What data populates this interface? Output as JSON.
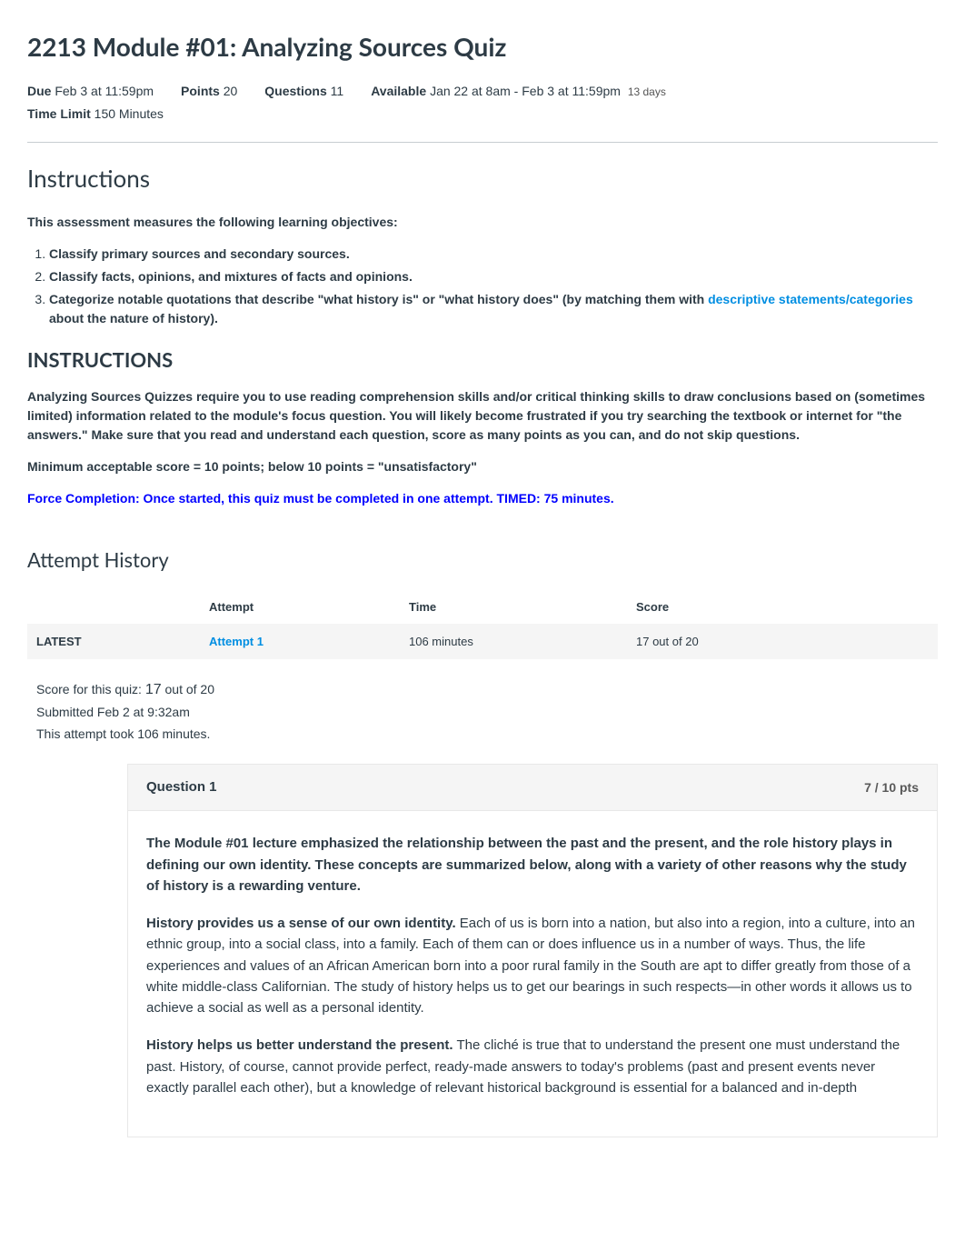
{
  "title": "2213 Module #01: Analyzing Sources Quiz",
  "meta": {
    "due_label": "Due",
    "due_value": "Feb 3 at 11:59pm",
    "points_label": "Points",
    "points_value": "20",
    "questions_label": "Questions",
    "questions_value": "11",
    "available_label": "Available",
    "available_value": "Jan 22 at 8am - Feb 3 at 11:59pm",
    "available_extra": "13 days",
    "timelimit_label": "Time Limit",
    "timelimit_value": "150 Minutes"
  },
  "instructions_heading": "Instructions",
  "objectives_intro": "This assessment measures the following learning objectives:",
  "objectives": {
    "o1": "Classify primary sources and secondary sources.",
    "o2": "Classify facts, opinions, and mixtures of facts and opinions.",
    "o3_lead": "Categorize notable quotations that describe \"what history is\" or \"what history does\" ",
    "o3_paren_a": "(by matching them with ",
    "o3_link": "descriptive statements/categories",
    "o3_paren_b": " about the nature of history)."
  },
  "sub_heading": "INSTRUCTIONS",
  "para1_a": "Analyzing Sources Quizzes require you to use reading comprehension skills and/or critical thinking skills to draw conclusions based on (sometimes limited) information related to the module's focus question. You will likely become frustrated if you try searching the textbook or internet for \"the answers.\"",
  "para1_b": " Make sure that you read and understand each question, score as many points as you can, and do not skip questions.",
  "para2": "Minimum acceptable score = 10 points; below 10 points = \"unsatisfactory\"",
  "para3": "Force Completion: Once started, this quiz must be completed in one attempt. TIMED: 75 minutes.",
  "attempt_heading": "Attempt History",
  "table": {
    "col_blank": "",
    "col_attempt": "Attempt",
    "col_time": "Time",
    "col_score": "Score",
    "row_latest": "LATEST",
    "row_attempt": "Attempt 1",
    "row_time": "106 minutes",
    "row_score": "17 out of 20"
  },
  "summary": {
    "line1_a": "Score for this quiz: ",
    "line1_b": "17",
    "line1_c": " out of 20",
    "line2": "Submitted Feb 2 at 9:32am",
    "line3": "This attempt took 106 minutes."
  },
  "question": {
    "title": "Question 1",
    "pts": "7 / 10 pts",
    "p1": "The Module #01 lecture emphasized the relationship between the past and the present, and the role history plays in defining our own identity. These concepts are summarized below, along with a variety of other reasons why the study of history is a rewarding venture.",
    "p2_lead": "History provides us a sense of our own identity.",
    "p2_body": " Each of us is born into a nation, but also into a region, into a culture, into an ethnic group, into a social class, into a family. Each of them can or does influence us in a number of ways. Thus, the life experiences and values of an African American born into a poor rural family in the South are apt to differ greatly from those of a white middle-class Californian. The study of history helps us to get our bearings in such respects—in other words it allows us to achieve a social as well as a personal identity.",
    "p3_lead": "History helps us better understand the present.",
    "p3_body": " The cliché is true that to understand the present one must understand the past. History, of course, cannot provide perfect, ready-made answers to today's problems (past and present events never exactly parallel each other), but a knowledge of relevant historical background is essential for a balanced and in-depth"
  }
}
